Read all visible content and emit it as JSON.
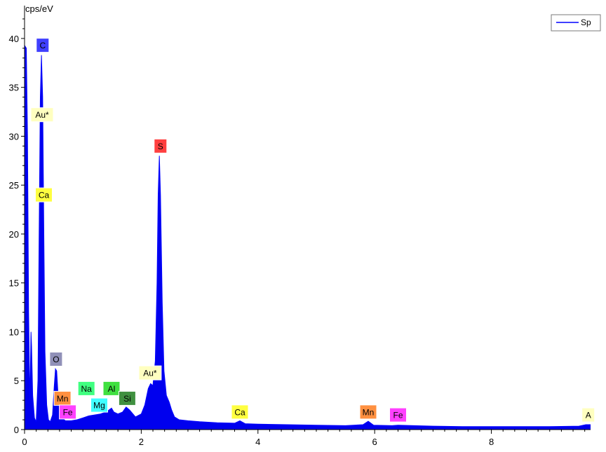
{
  "chart_data": {
    "type": "area",
    "title": "",
    "ylabel": "cps/eV",
    "xlabel": "",
    "xlim": [
      0,
      9.7
    ],
    "ylim": [
      0,
      42.5
    ],
    "grid": false,
    "x_ticks": [
      0,
      2,
      4,
      6,
      8
    ],
    "y_ticks": [
      0,
      5,
      10,
      15,
      20,
      25,
      30,
      35,
      40
    ],
    "legend": {
      "position": "top-right",
      "label": "Sp"
    },
    "series": [
      {
        "color": "#0000ff",
        "fill": "#0000ee",
        "points": [
          [
            0.0,
            0.0
          ],
          [
            0.01,
            39.2
          ],
          [
            0.03,
            39.0
          ],
          [
            0.05,
            30.0
          ],
          [
            0.07,
            12.0
          ],
          [
            0.09,
            3.0
          ],
          [
            0.1,
            6.0
          ],
          [
            0.11,
            10.0
          ],
          [
            0.12,
            8.5
          ],
          [
            0.14,
            3.5
          ],
          [
            0.17,
            1.2
          ],
          [
            0.2,
            0.8
          ],
          [
            0.23,
            5.0
          ],
          [
            0.25,
            20.0
          ],
          [
            0.27,
            34.0
          ],
          [
            0.29,
            38.3
          ],
          [
            0.31,
            34.0
          ],
          [
            0.33,
            20.0
          ],
          [
            0.35,
            8.0
          ],
          [
            0.38,
            2.5
          ],
          [
            0.41,
            1.0
          ],
          [
            0.44,
            0.8
          ],
          [
            0.48,
            1.5
          ],
          [
            0.51,
            4.5
          ],
          [
            0.53,
            6.2
          ],
          [
            0.55,
            6.0
          ],
          [
            0.57,
            4.0
          ],
          [
            0.6,
            2.0
          ],
          [
            0.64,
            1.2
          ],
          [
            0.7,
            0.9
          ],
          [
            0.8,
            0.9
          ],
          [
            0.9,
            1.0
          ],
          [
            1.0,
            1.2
          ],
          [
            1.1,
            1.4
          ],
          [
            1.2,
            1.5
          ],
          [
            1.3,
            1.6
          ],
          [
            1.4,
            1.8
          ],
          [
            1.49,
            2.2
          ],
          [
            1.53,
            1.8
          ],
          [
            1.6,
            1.6
          ],
          [
            1.68,
            1.8
          ],
          [
            1.74,
            2.3
          ],
          [
            1.8,
            2.0
          ],
          [
            1.9,
            1.3
          ],
          [
            2.0,
            1.6
          ],
          [
            2.06,
            2.5
          ],
          [
            2.12,
            4.2
          ],
          [
            2.16,
            4.7
          ],
          [
            2.2,
            4.5
          ],
          [
            2.24,
            7.0
          ],
          [
            2.27,
            15.0
          ],
          [
            2.29,
            24.0
          ],
          [
            2.31,
            28.0
          ],
          [
            2.33,
            24.0
          ],
          [
            2.36,
            13.0
          ],
          [
            2.39,
            6.0
          ],
          [
            2.43,
            3.5
          ],
          [
            2.48,
            2.8
          ],
          [
            2.52,
            2.0
          ],
          [
            2.57,
            1.3
          ],
          [
            2.65,
            1.0
          ],
          [
            2.8,
            0.9
          ],
          [
            3.0,
            0.8
          ],
          [
            3.3,
            0.7
          ],
          [
            3.6,
            0.65
          ],
          [
            3.69,
            0.9
          ],
          [
            3.78,
            0.6
          ],
          [
            4.0,
            0.55
          ],
          [
            4.5,
            0.5
          ],
          [
            5.0,
            0.45
          ],
          [
            5.5,
            0.4
          ],
          [
            5.8,
            0.5
          ],
          [
            5.89,
            0.85
          ],
          [
            5.98,
            0.45
          ],
          [
            6.3,
            0.4
          ],
          [
            6.4,
            0.45
          ],
          [
            7.0,
            0.35
          ],
          [
            7.5,
            0.3
          ],
          [
            8.0,
            0.3
          ],
          [
            8.5,
            0.3
          ],
          [
            9.0,
            0.3
          ],
          [
            9.5,
            0.35
          ],
          [
            9.62,
            0.5
          ],
          [
            9.7,
            0.5
          ]
        ]
      }
    ],
    "element_labels": [
      {
        "text": "C",
        "x": 0.31,
        "y": 39.3,
        "bg": "#4040ff",
        "fg": "#ffffff"
      },
      {
        "text": "Au*",
        "x": 0.3,
        "y": 32.2,
        "bg": "#ffffc0",
        "fg": "#000000"
      },
      {
        "text": "Ca",
        "x": 0.33,
        "y": 24.0,
        "bg": "#ffff40",
        "fg": "#000000"
      },
      {
        "text": "S",
        "x": 2.33,
        "y": 29.0,
        "bg": "#ff4040",
        "fg": "#000000"
      },
      {
        "text": "O",
        "x": 0.54,
        "y": 7.2,
        "bg": "#9090b8",
        "fg": "#000000"
      },
      {
        "text": "Na",
        "x": 1.06,
        "y": 4.2,
        "bg": "#40ff80",
        "fg": "#000000"
      },
      {
        "text": "Al",
        "x": 1.49,
        "y": 4.2,
        "bg": "#40e040",
        "fg": "#000000"
      },
      {
        "text": "Au*",
        "x": 2.15,
        "y": 5.8,
        "bg": "#ffffc0",
        "fg": "#000000"
      },
      {
        "text": "Mn",
        "x": 0.65,
        "y": 3.2,
        "bg": "#ff9040",
        "fg": "#000000"
      },
      {
        "text": "Mg",
        "x": 1.28,
        "y": 2.5,
        "bg": "#40ffff",
        "fg": "#000000"
      },
      {
        "text": "Si",
        "x": 1.76,
        "y": 3.2,
        "bg": "#409040",
        "fg": "#ffffff"
      },
      {
        "text": "Fe",
        "x": 0.74,
        "y": 1.8,
        "bg": "#ff40ff",
        "fg": "#000000"
      },
      {
        "text": "Ca",
        "x": 3.69,
        "y": 1.8,
        "bg": "#ffff40",
        "fg": "#000000"
      },
      {
        "text": "Mn",
        "x": 5.89,
        "y": 1.8,
        "bg": "#ff9040",
        "fg": "#000000"
      },
      {
        "text": "Fe",
        "x": 6.4,
        "y": 1.5,
        "bg": "#ff40ff",
        "fg": "#000000"
      },
      {
        "text": "A",
        "x": 9.66,
        "y": 1.5,
        "bg": "#ffffc0",
        "fg": "#000000"
      }
    ]
  }
}
